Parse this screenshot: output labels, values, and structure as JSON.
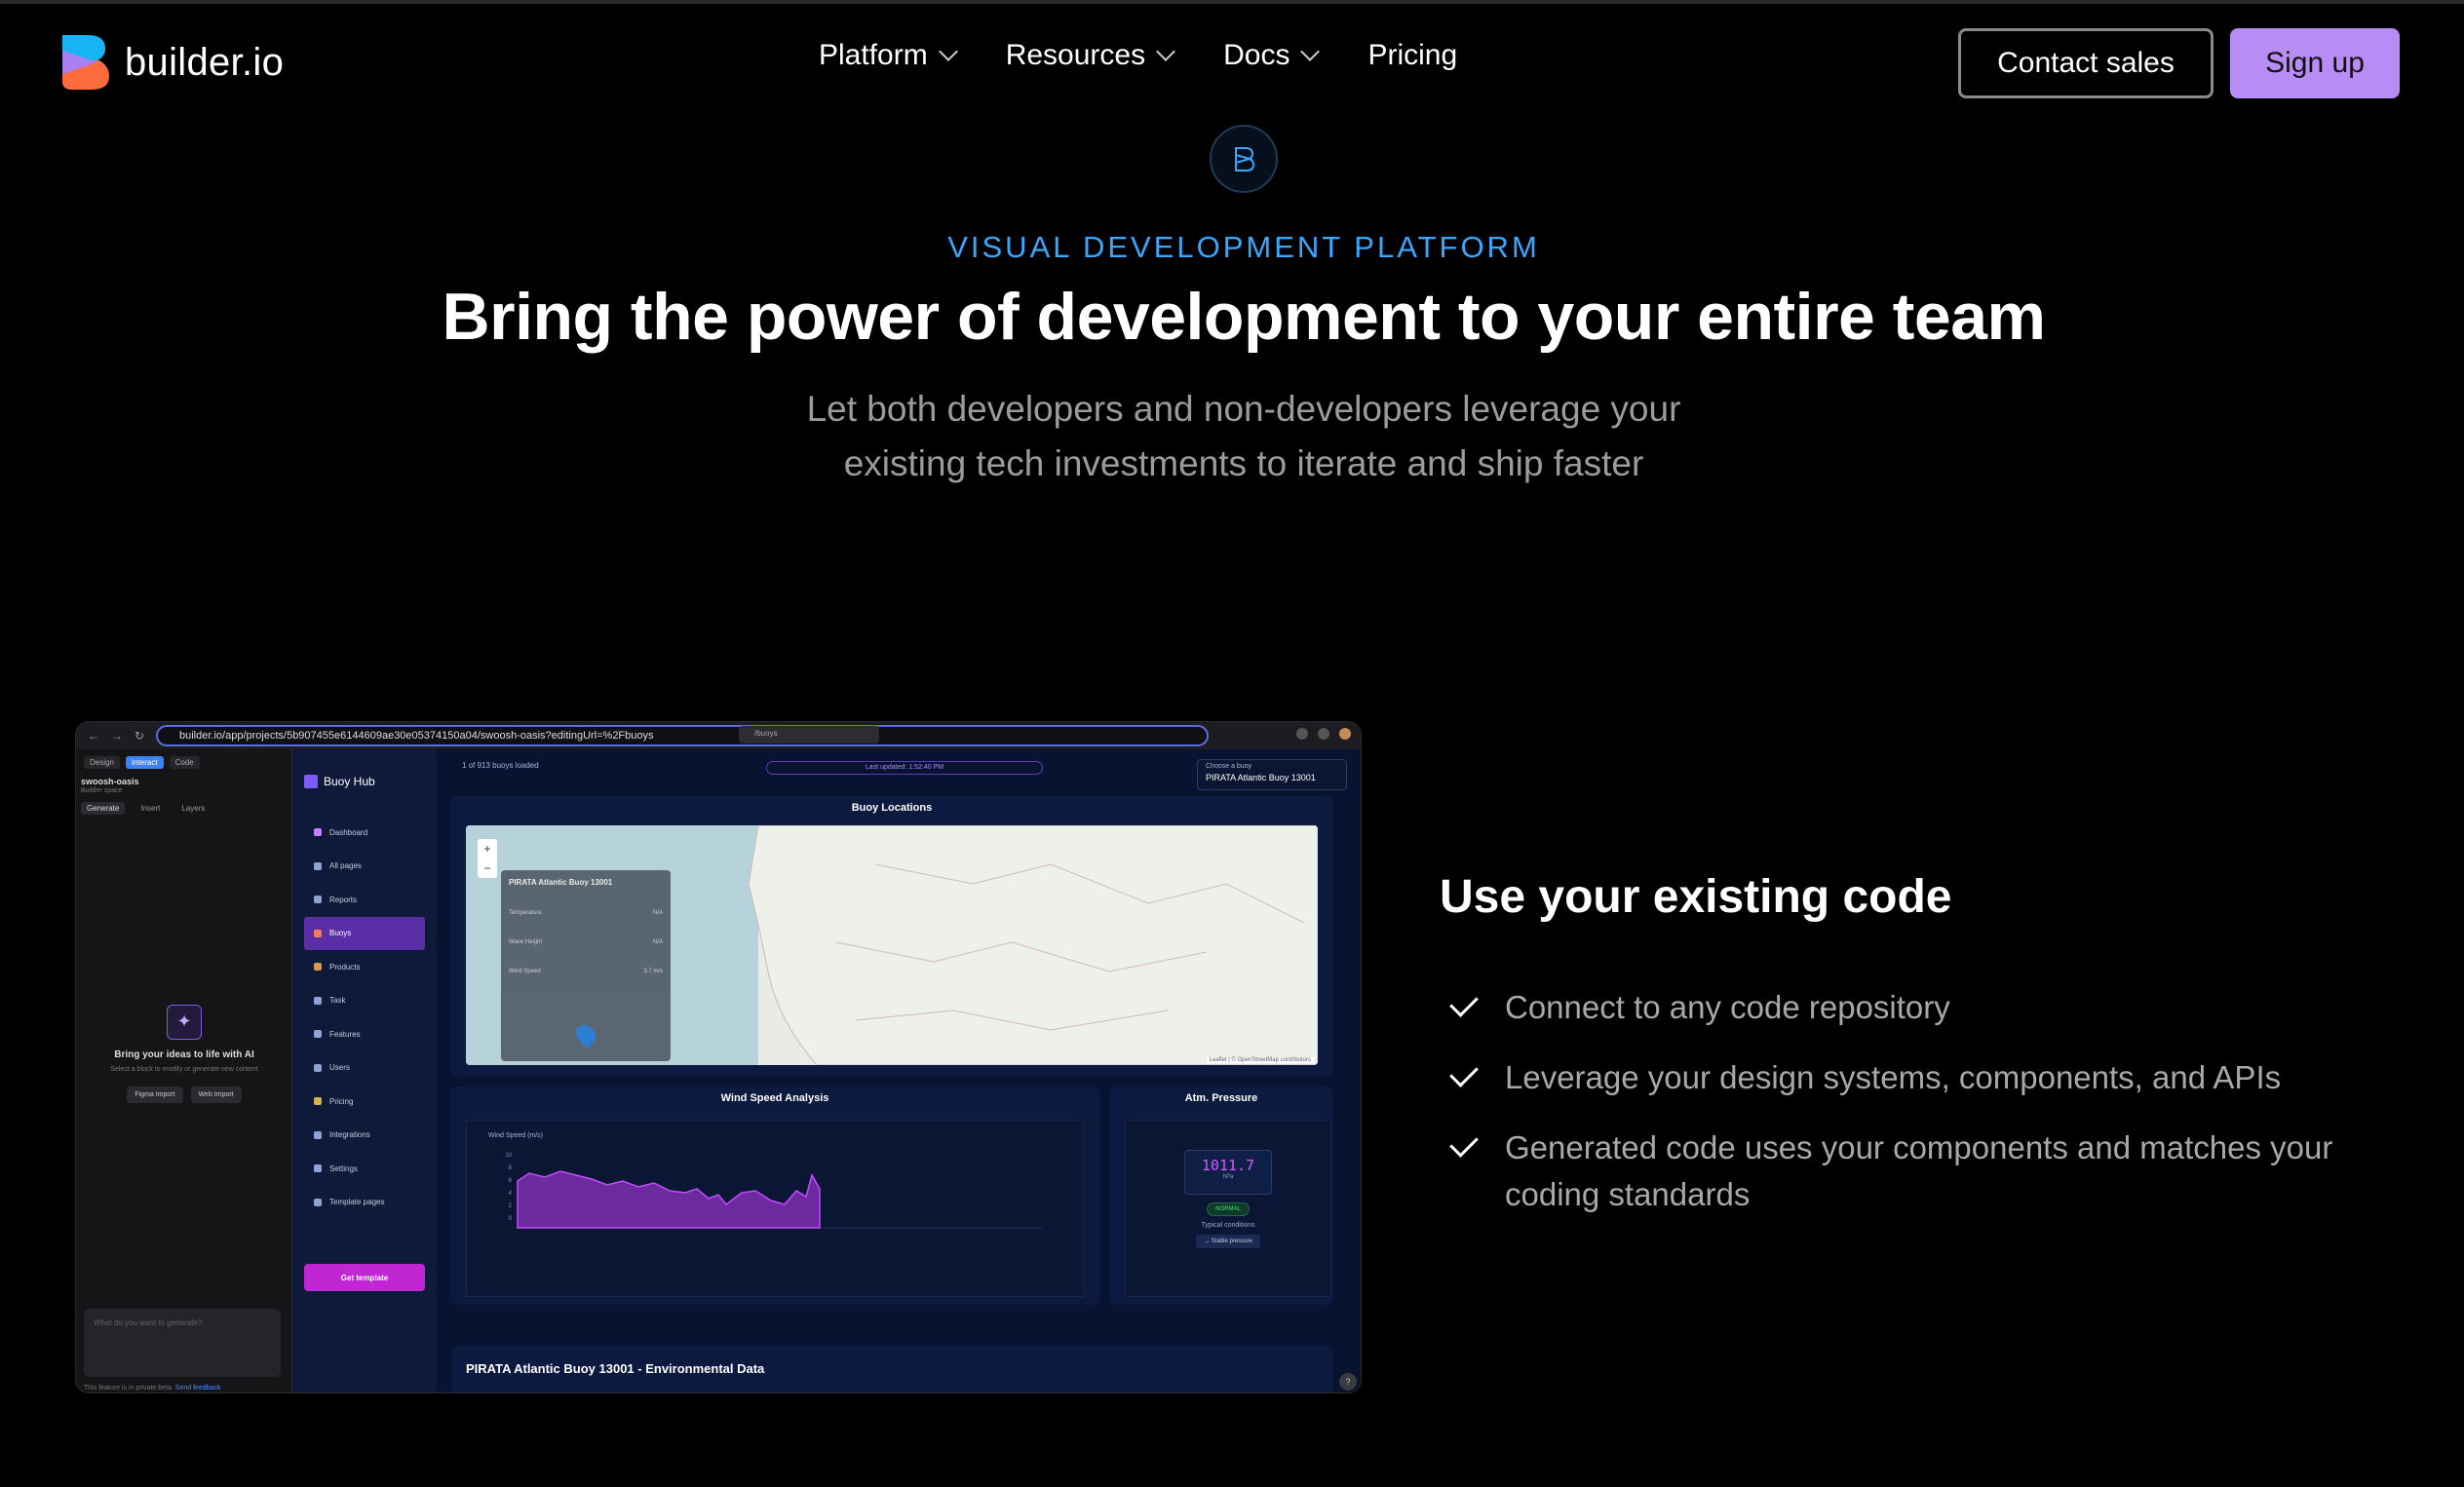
{
  "nav": {
    "logo_text": "builder.io",
    "menu": [
      {
        "label": "Platform",
        "has_dropdown": true
      },
      {
        "label": "Resources",
        "has_dropdown": true
      },
      {
        "label": "Docs",
        "has_dropdown": true
      },
      {
        "label": "Pricing",
        "has_dropdown": false
      }
    ],
    "contact_sales": "Contact sales",
    "sign_up": "Sign up"
  },
  "hero": {
    "eyebrow": "VISUAL DEVELOPMENT PLATFORM",
    "headline": "Bring the power of development to your entire team",
    "subline1": "Let both developers and non-developers leverage your",
    "subline2": "existing tech investments to iterate and ship faster"
  },
  "feature": {
    "title": "Use your existing code",
    "items": [
      "Connect to any code repository",
      "Leverage your design systems, components, and APIs",
      "Generated code uses your components and matches your coding standards"
    ]
  },
  "screenshot": {
    "url": "builder.io/app/projects/5b907455e6144609ae30e05374150a04/swoosh-oasis?editingUrl=%2Fbuoys",
    "editor_tabs": [
      "Design",
      "Interact",
      "Code"
    ],
    "project_name": "swoosh-oasis",
    "project_space": "Builder space",
    "generate_tabs": [
      "Generate",
      "Insert",
      "Layers"
    ],
    "ai_title": "Bring your ideas to life with AI",
    "ai_sub": "Select a block to modify or generate new content",
    "figma_import": "Figma Import",
    "web_import": "Web Import",
    "prompt_placeholder": "What do you want to generate?",
    "private_note": "This feature is in private beta.",
    "send_feedback": "Send feedback",
    "path": "/buoys",
    "app_name": "Buoy Hub",
    "sidebar": [
      "Dashboard",
      "All pages",
      "Reports",
      "Buoys",
      "Products",
      "Task",
      "Features",
      "Users",
      "Pricing",
      "Integrations",
      "Settings",
      "Template pages"
    ],
    "active_sidebar": "Buoys",
    "get_template": "Get template",
    "loaded": "1 of 913 buoys loaded",
    "last_updated": "Last updated: 1:52:40 PM",
    "choose_label": "Choose a buoy",
    "choose_value": "PIRATA Atlantic Buoy 13001",
    "map_title": "Buoy Locations",
    "popup_title": "PIRATA Atlantic Buoy 13001",
    "popup_rows": [
      {
        "label": "Temperature",
        "value": "N/A"
      },
      {
        "label": "Wave Height",
        "value": "N/A"
      },
      {
        "label": "Wind Speed",
        "value": "3.7 m/s"
      }
    ],
    "map_attrib": "Leaflet | © OpenStreetMap contributors",
    "wind_title": "Wind Speed Analysis",
    "wind_ylabel": "Wind Speed (m/s)",
    "wind_yticks": [
      "10",
      "8",
      "6",
      "4",
      "2",
      "0"
    ],
    "pressure_title": "Atm. Pressure",
    "pressure_value": "1011.7",
    "pressure_unit": "hPa",
    "pressure_status": "NORMAL",
    "pressure_note": "Typical conditions",
    "pressure_trend": "→ Stable pressure",
    "env_title": "PIRATA Atlantic Buoy 13001 - Environmental Data"
  },
  "colors": {
    "accent_blue": "#3aa7ff",
    "signup_bg": "#b78cf5",
    "active_purple": "#5b2ea6"
  }
}
